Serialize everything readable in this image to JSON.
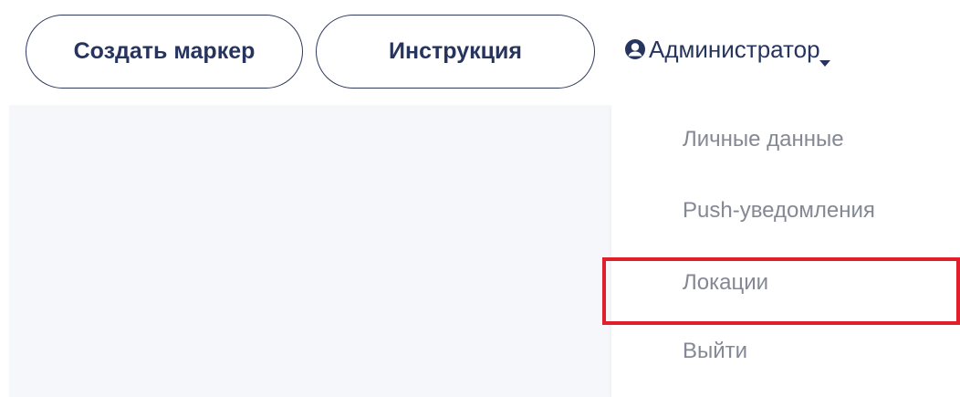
{
  "header": {
    "create_marker_label": "Создать маркер",
    "instruction_label": "Инструкция",
    "user_menu": {
      "label": "Администратор",
      "icon": "user-circle-icon",
      "caret_icon": "caret-down-icon"
    }
  },
  "dropdown": {
    "items": [
      {
        "label": "Личные данные"
      },
      {
        "label": "Push-уведомления"
      },
      {
        "label": "Локации",
        "highlighted": true
      },
      {
        "label": "Выйти"
      }
    ]
  },
  "colors": {
    "primary_text": "#27345e",
    "muted_text": "#848894",
    "panel_bg": "#f6f7fa",
    "highlight": "#e01f2a"
  }
}
